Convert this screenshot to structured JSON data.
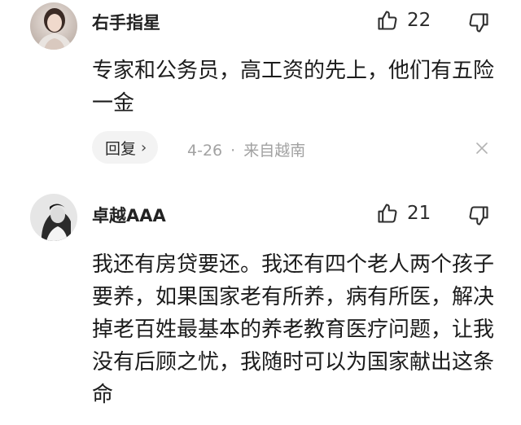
{
  "comments": [
    {
      "username": "右手指星",
      "likes": "22",
      "text": "专家和公务员，高工资的先上，他们有五险一金",
      "reply_label": "回复",
      "date": "4-26",
      "separator": "·",
      "location": "来自越南"
    },
    {
      "username": "卓越AAA",
      "likes": "21",
      "text": "我还有房贷要还。我还有四个老人两个孩子要养，如果国家老有所养，病有所医，解决掉老百姓最基本的养老教育医疗问题，让我没有后顾之忧，我随时可以为国家献出这条命"
    }
  ],
  "icons": {
    "like": "thumbs-up-icon",
    "dislike": "thumbs-down-icon",
    "chevron": "chevron-right-icon",
    "close": "close-icon"
  },
  "colors": {
    "text": "#1c1c1c",
    "meta": "#a2a2a2",
    "reply_bg": "#f3f3f3"
  }
}
